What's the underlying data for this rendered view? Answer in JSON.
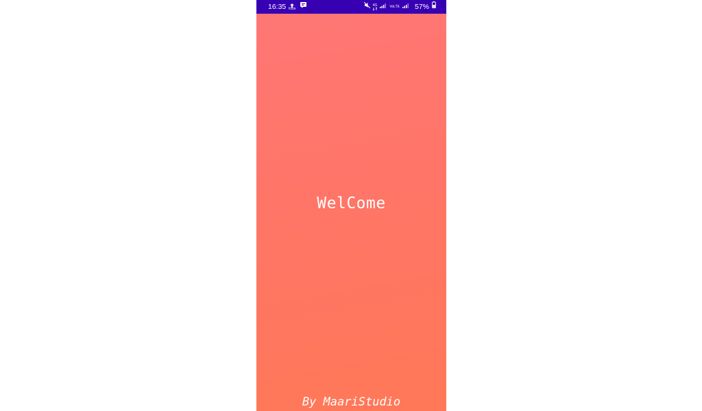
{
  "status_bar": {
    "time": "16:35",
    "left_icons": [
      "data-speed-icon",
      "message-icon"
    ],
    "left_small_label": "KB/s",
    "network_type": "4G",
    "volte_label": "VoLTE",
    "right_icons": [
      "mute-icon",
      "signal-icon",
      "signal-icon",
      "battery-icon"
    ],
    "battery": "57%",
    "background_color": "#3700b3"
  },
  "screen": {
    "welcome_text": "WelCome",
    "credit_text": "By MaariStudio",
    "gradient_colors": [
      "#ff7776",
      "#ff7857"
    ]
  }
}
